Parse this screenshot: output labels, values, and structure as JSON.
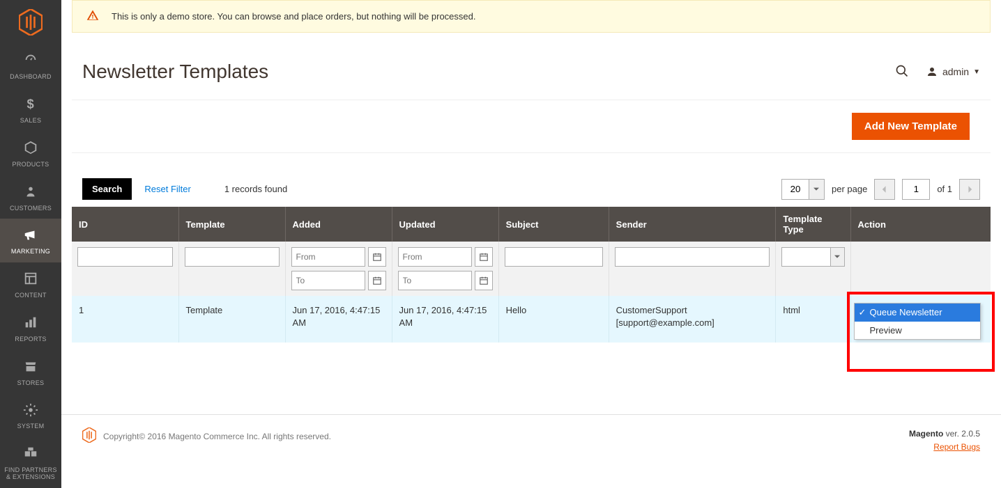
{
  "notice": {
    "text": "This is only a demo store. You can browse and place orders, but nothing will be processed."
  },
  "sidebar": {
    "items": [
      {
        "label": "DASHBOARD",
        "icon": "dashboard-icon"
      },
      {
        "label": "SALES",
        "icon": "dollar-icon"
      },
      {
        "label": "PRODUCTS",
        "icon": "cube-icon"
      },
      {
        "label": "CUSTOMERS",
        "icon": "person-icon"
      },
      {
        "label": "MARKETING",
        "icon": "megaphone-icon"
      },
      {
        "label": "CONTENT",
        "icon": "layout-icon"
      },
      {
        "label": "REPORTS",
        "icon": "bars-icon"
      },
      {
        "label": "STORES",
        "icon": "store-icon"
      },
      {
        "label": "SYSTEM",
        "icon": "gear-icon"
      },
      {
        "label": "FIND PARTNERS & EXTENSIONS",
        "icon": "partners-icon"
      }
    ]
  },
  "header": {
    "title": "Newsletter Templates",
    "user_label": "admin"
  },
  "buttons": {
    "add_new": "Add New Template",
    "search": "Search",
    "reset_filter": "Reset Filter"
  },
  "toolbar": {
    "records_found": "1 records found",
    "per_page_value": "20",
    "per_page_label": "per page",
    "page_value": "1",
    "page_total_label": "of 1"
  },
  "grid": {
    "columns": [
      "ID",
      "Template",
      "Added",
      "Updated",
      "Subject",
      "Sender",
      "Template Type",
      "Action"
    ],
    "filters": {
      "from_placeholder": "From",
      "to_placeholder": "To"
    },
    "rows": [
      {
        "id": "1",
        "template": "Template",
        "added": "Jun 17, 2016, 4:47:15 AM",
        "updated": "Jun 17, 2016, 4:47:15 AM",
        "subject": "Hello",
        "sender": "CustomerSupport [support@example.com]",
        "type": "html"
      }
    ],
    "action_menu": {
      "options": [
        "Queue Newsletter",
        "Preview"
      ],
      "selected": "Queue Newsletter"
    }
  },
  "footer": {
    "copyright": "Copyright© 2016 Magento Commerce Inc. All rights reserved.",
    "product": "Magento",
    "version": " ver. 2.0.5",
    "bugs": "Report Bugs"
  }
}
